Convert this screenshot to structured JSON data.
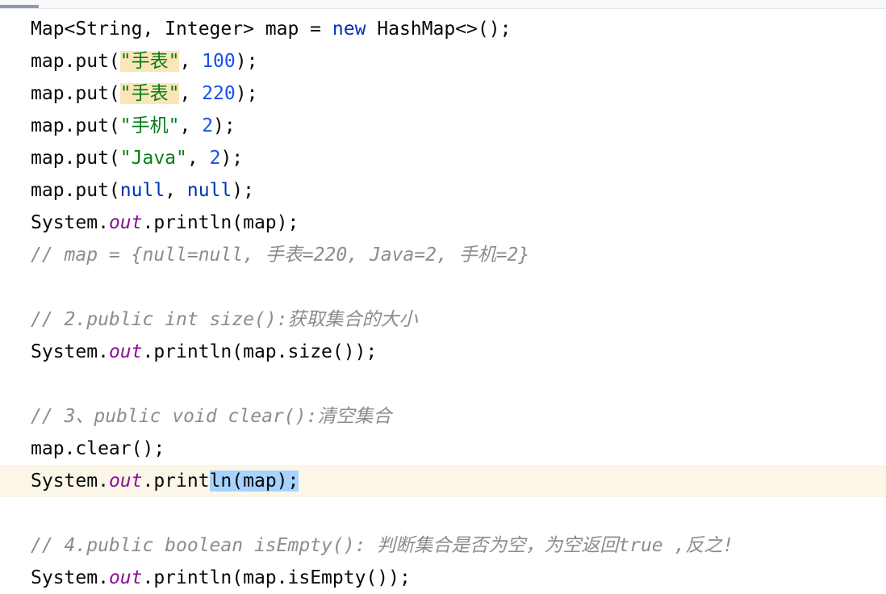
{
  "lines": [
    [
      "Map<String, Integer> map = ",
      "new",
      " HashMap<>();"
    ],
    [
      "map.put(",
      "\"手表\"",
      ", ",
      "100",
      ");"
    ],
    [
      "map.put(",
      "\"手表\"",
      ", ",
      "220",
      ");"
    ],
    [
      "map.put(",
      "\"手机\"",
      ", ",
      "2",
      ");"
    ],
    [
      "map.put(",
      "\"Java\"",
      ", ",
      "2",
      ");"
    ],
    [
      "map.put(",
      "null",
      ", ",
      "null",
      ");"
    ],
    [
      "System.",
      "out",
      ".println(map);"
    ],
    [
      "// map = {null=null, 手表=220, Java=2, 手机=2}"
    ],
    [
      "// 2.public int size():获取集合的大小"
    ],
    [
      "System.",
      "out",
      ".println(map.size());"
    ],
    [
      "// 3、public void clear():清空集合"
    ],
    [
      "map.clear();"
    ],
    [
      "System.",
      "out",
      ".print",
      "ln(map);"
    ],
    [
      "// 4.public boolean isEmpty(): 判断集合是否为空，为空返回true ,反之!"
    ],
    [
      "System.",
      "out",
      ".println(map.isEmpty());"
    ]
  ]
}
